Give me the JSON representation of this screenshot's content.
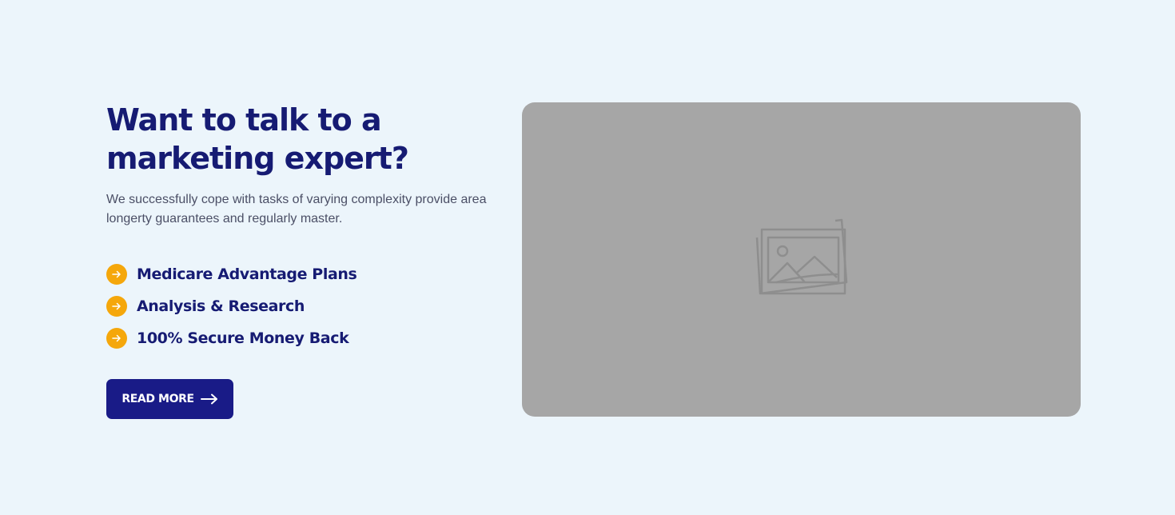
{
  "cta_section": {
    "heading": "Want to talk to a marketing expert?",
    "description": "We successfully cope with tasks of varying complexity provide area longerty guarantees and regularly master.",
    "features": [
      {
        "label": "Medicare Advantage Plans",
        "icon": "arrow-right-icon"
      },
      {
        "label": "Analysis & Research",
        "icon": "arrow-right-icon"
      },
      {
        "label": "100% Secure Money Back",
        "icon": "arrow-right-icon"
      }
    ],
    "button": {
      "label": "READ MORE",
      "icon": "long-arrow-right-icon"
    },
    "image": {
      "icon": "image-placeholder-icon"
    }
  },
  "colors": {
    "background": "#ecf5fb",
    "heading": "#161b73",
    "body_text": "#4b4f66",
    "accent": "#f5a70b",
    "button": "#191b87",
    "placeholder": "#a6a6a6"
  }
}
